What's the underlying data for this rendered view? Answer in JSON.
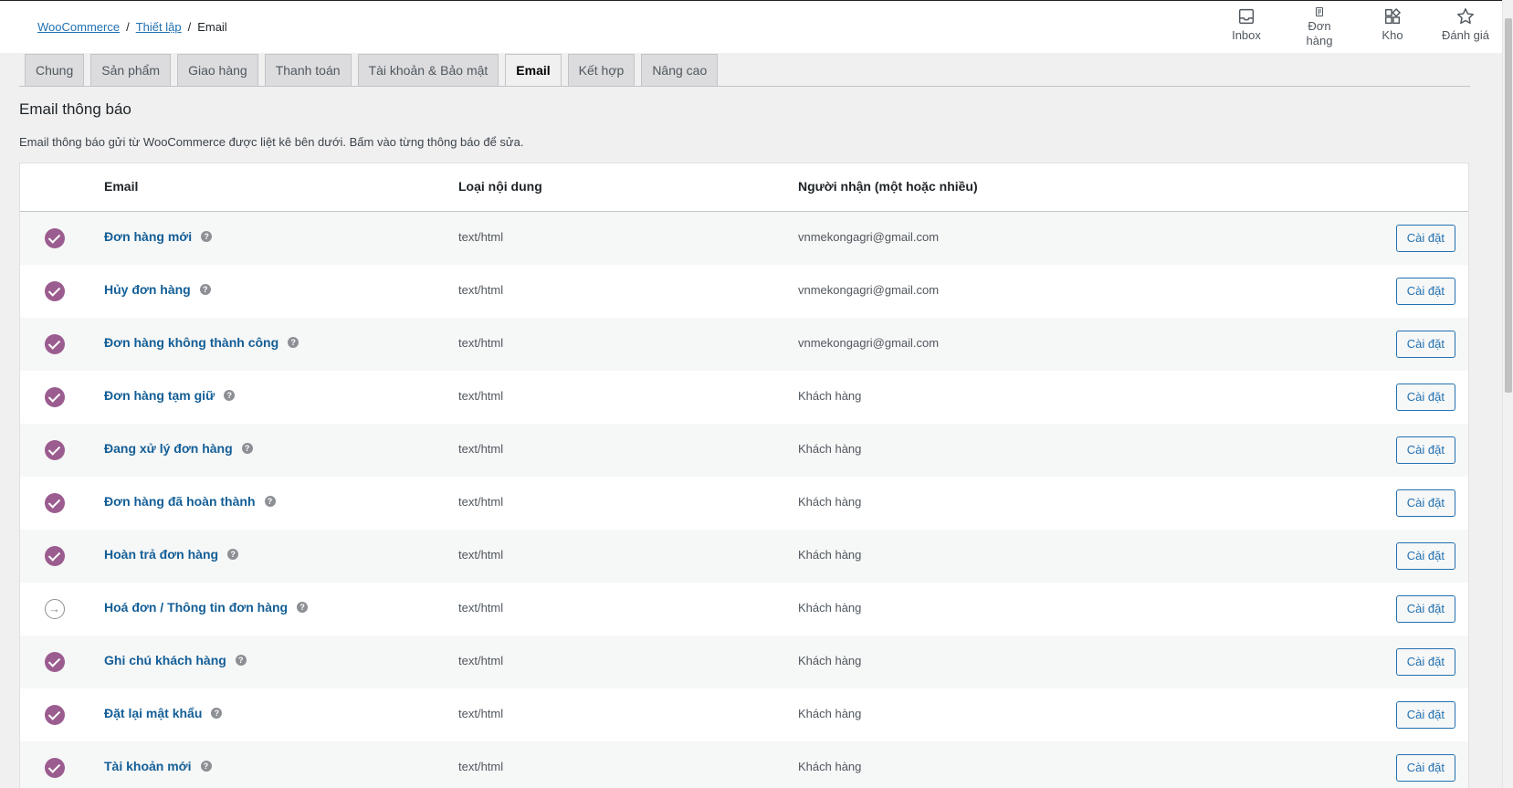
{
  "breadcrumb": {
    "items": [
      {
        "label": "WooCommerce",
        "link": true
      },
      {
        "label": "Thiết lập",
        "link": true
      },
      {
        "label": "Email",
        "link": false
      }
    ],
    "separator": "/"
  },
  "topnav": {
    "inbox": "Inbox",
    "orders": "Đơn hàng",
    "stock": "Kho",
    "reviews": "Đánh giá"
  },
  "tabs": [
    {
      "label": "Chung",
      "active": false
    },
    {
      "label": "Sản phẩm",
      "active": false
    },
    {
      "label": "Giao hàng",
      "active": false
    },
    {
      "label": "Thanh toán",
      "active": false
    },
    {
      "label": "Tài khoản & Bảo mật",
      "active": false
    },
    {
      "label": "Email",
      "active": true
    },
    {
      "label": "Kết hợp",
      "active": false
    },
    {
      "label": "Nâng cao",
      "active": false
    }
  ],
  "page": {
    "title": "Email thông báo",
    "description": "Email thông báo gửi từ WooCommerce được liệt kê bên dưới. Bấm vào từng thông báo để sửa."
  },
  "table": {
    "headers": {
      "email": "Email",
      "content_type": "Loại nội dung",
      "recipient": "Người nhận (một hoặc nhiều)"
    },
    "button_label": "Cài đặt",
    "help_glyph": "?",
    "rows": [
      {
        "name": "Đơn hàng mới",
        "type": "text/html",
        "recipient": "vnmekongagri@gmail.com",
        "enabled": true
      },
      {
        "name": "Hủy đơn hàng",
        "type": "text/html",
        "recipient": "vnmekongagri@gmail.com",
        "enabled": true
      },
      {
        "name": "Đơn hàng không thành công",
        "type": "text/html",
        "recipient": "vnmekongagri@gmail.com",
        "enabled": true
      },
      {
        "name": "Đơn hàng tạm giữ",
        "type": "text/html",
        "recipient": "Khách hàng",
        "enabled": true
      },
      {
        "name": "Đang xử lý đơn hàng",
        "type": "text/html",
        "recipient": "Khách hàng",
        "enabled": true
      },
      {
        "name": "Đơn hàng đã hoàn thành",
        "type": "text/html",
        "recipient": "Khách hàng",
        "enabled": true
      },
      {
        "name": "Hoàn trả đơn hàng",
        "type": "text/html",
        "recipient": "Khách hàng",
        "enabled": true
      },
      {
        "name": "Hoá đơn / Thông tin đơn hàng",
        "type": "text/html",
        "recipient": "Khách hàng",
        "enabled": false
      },
      {
        "name": "Ghi chú khách hàng",
        "type": "text/html",
        "recipient": "Khách hàng",
        "enabled": true
      },
      {
        "name": "Đặt lại mật khẩu",
        "type": "text/html",
        "recipient": "Khách hàng",
        "enabled": true
      },
      {
        "name": "Tài khoản mới",
        "type": "text/html",
        "recipient": "Khách hàng",
        "enabled": true
      }
    ]
  },
  "colors": {
    "accent": "#9b5c8f",
    "link": "#135e96",
    "button": "#2271b1"
  }
}
